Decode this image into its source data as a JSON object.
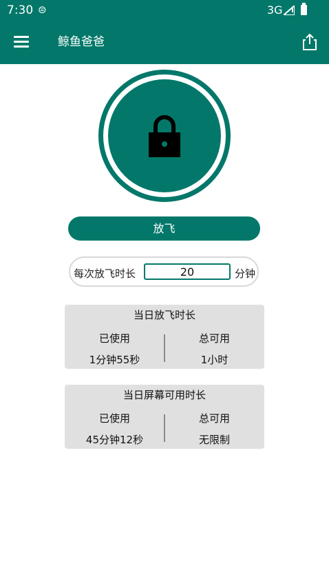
{
  "status_bar": {
    "time": "7:30",
    "network": "3G"
  },
  "app_bar": {
    "title": "鲸鱼爸爸"
  },
  "lock": {
    "icon": "lock-icon",
    "color": "#03786a"
  },
  "release_button": {
    "label": "放飞"
  },
  "duration": {
    "label": "每次放飞时长",
    "value": "20",
    "unit": "分钟"
  },
  "daily_release": {
    "title": "当日放飞时长",
    "used_label": "已使用",
    "used_value": "1分钟55秒",
    "available_label": "总可用",
    "available_value": "1小时"
  },
  "daily_screen": {
    "title": "当日屏幕可用时长",
    "used_label": "已使用",
    "used_value": "45分钟12秒",
    "available_label": "总可用",
    "available_value": "无限制"
  }
}
